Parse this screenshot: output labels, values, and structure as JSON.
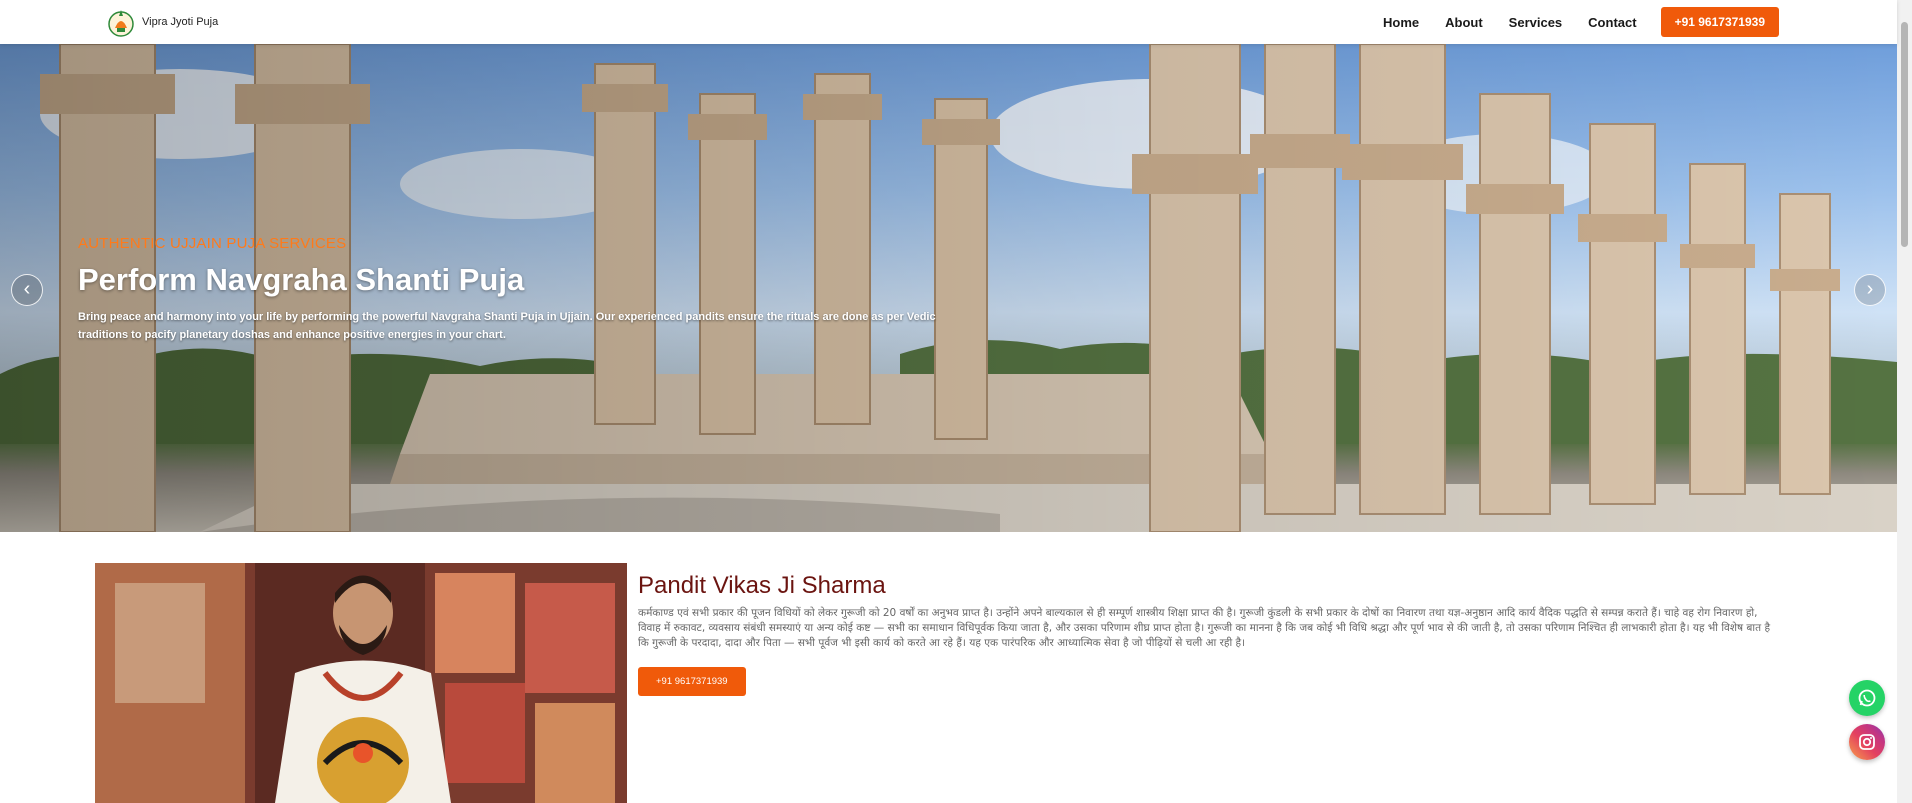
{
  "navbar": {
    "brand_name": "Vipra Jyoti Puja",
    "links": [
      "Home",
      "About",
      "Services",
      "Contact"
    ],
    "cta_label": "+91 9617371939"
  },
  "hero": {
    "kicker": "AUTHENTIC UJJAIN PUJA SERVICES",
    "title": "Perform Navgraha Shanti Puja",
    "description": "Bring peace and harmony into your life by performing the powerful Navgraha Shanti Puja in Ujjain. Our experienced pandits ensure the rituals are done as per Vedic traditions to pacify planetary doshas and enhance positive energies in your chart.",
    "prev_symbol": "‹",
    "next_symbol": "›"
  },
  "about": {
    "name": "Pandit Vikas Ji Sharma",
    "bio": "कर्मकाण्ड एवं सभी प्रकार की पूजन विधियों को लेकर गुरूजी को 20 वर्षों का अनुभव प्राप्त है। उन्होंने अपने बाल्यकाल से ही सम्पूर्ण शास्त्रीय शिक्षा प्राप्त की है। गुरूजी कुंडली के सभी प्रकार के दोषों का निवारण तथा यज्ञ-अनुष्ठान आदि कार्य वैदिक पद्धति से सम्पन्न कराते हैं। चाहे वह रोग निवारण हो, विवाह में रुकावट, व्यवसाय संबंधी समस्याएं या अन्य कोई कष्ट — सभी का समाधान विधिपूर्वक किया जाता है, और उसका परिणाम शीघ्र प्राप्त होता है। गुरूजी का मानना है कि जब कोई भी विधि श्रद्धा और पूर्ण भाव से की जाती है, तो उसका परिणाम निश्चित ही लाभकारी होता है। यह भी विशेष बात है कि गुरूजी के परदादा, दादा और पिता — सभी पूर्वज भी इसी कार्य को करते आ रहे हैं। यह एक पारंपरिक और आध्यात्मिक सेवा है जो पीढ़ियों से चली आ रही है।",
    "cta_label": "+91 9617371939"
  },
  "floating": {
    "whatsapp_icon": "whatsapp-icon",
    "instagram_icon": "instagram-icon"
  },
  "colors": {
    "accent": "#f05a0a",
    "kicker": "#ff7a1a",
    "name": "#6b1410",
    "whatsapp": "#25d366"
  }
}
